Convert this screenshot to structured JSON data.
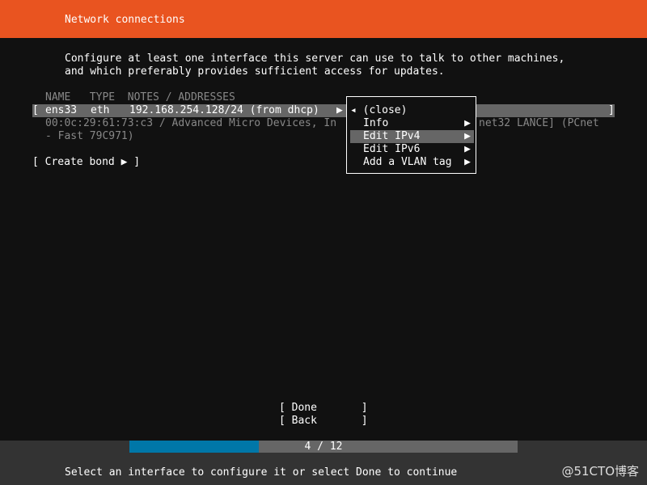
{
  "header": {
    "title": "Network connections"
  },
  "intro": [
    "Configure at least one interface this server can use to talk to other machines,",
    "and which preferably provides sufficient access for updates."
  ],
  "table": {
    "columns": "NAME   TYPE  NOTES / ADDRESSES",
    "row": {
      "open": "[",
      "name": "ens33",
      "type": "eth",
      "address": "192.168.254.128/24 (from dhcp)",
      "arrow": "▶",
      "close": "]"
    },
    "detail_left": "00:0c:29:61:73:c3 / Advanced Micro Devices, In",
    "detail_right": "net32 LANCE] (PCnet",
    "detail_line2": "- Fast 79C971)"
  },
  "create_bond": "[ Create bond ▶ ]",
  "menu": {
    "items": [
      {
        "label": "◂ (close)",
        "arrow": ""
      },
      {
        "label": "Info",
        "arrow": "▶"
      },
      {
        "label": "Edit IPv4",
        "arrow": "▶",
        "selected": true
      },
      {
        "label": "Edit IPv6",
        "arrow": "▶"
      },
      {
        "label": "Add a VLAN tag",
        "arrow": "▶"
      }
    ]
  },
  "buttons": {
    "done": "[ Done       ]",
    "back": "[ Back       ]"
  },
  "progress": {
    "current": 4,
    "total": 12,
    "label": "4 / 12",
    "fill_color": "#0077a8"
  },
  "status": "Select an interface to configure it or select Done to continue",
  "watermark": "@51CTO博客",
  "colors": {
    "header": "#E95420",
    "background": "#111111",
    "highlight": "#666666"
  }
}
